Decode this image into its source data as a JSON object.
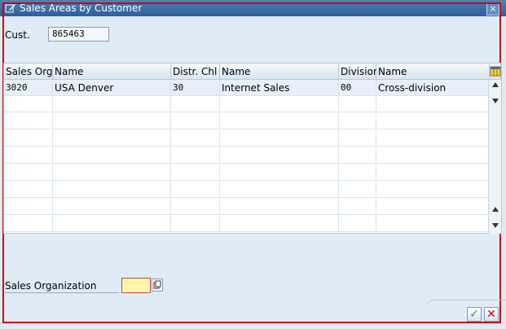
{
  "window": {
    "title": "Sales Areas by Customer",
    "close_glyph": "×"
  },
  "customer": {
    "label": "Cust.",
    "value": "865463"
  },
  "table": {
    "headers": [
      "Sales Org.",
      "Name",
      "Distr. Chl",
      "Name",
      "Division",
      "Name"
    ],
    "rows": [
      [
        "3020",
        "USA Denver",
        "30",
        "Internet Sales",
        "00",
        "Cross-division"
      ]
    ],
    "empty_rows": 8
  },
  "sales_org": {
    "label": "Sales Organization",
    "value": ""
  },
  "buttons": {
    "ok": "✓",
    "cancel": "✕"
  },
  "colors": {
    "titlebar": "#2c5f9a",
    "frame": "#d00000",
    "ok_green": "#2f9a2f",
    "cancel_red": "#d00000",
    "input_highlight": "#fff7b0"
  }
}
